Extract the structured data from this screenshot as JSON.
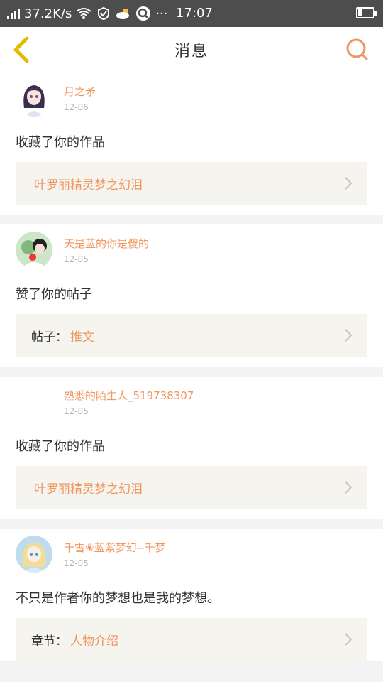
{
  "statusbar": {
    "speed": "37.2K/s",
    "time": "17:07",
    "dots": "···"
  },
  "header": {
    "title": "消息"
  },
  "notifications": [
    {
      "username": "月之矛",
      "date": "12-06",
      "action": "收藏了你的作品",
      "target_prefix": "",
      "target_value": "叶罗丽精灵梦之幻泪",
      "avatar_icon": "avatar-girl-purple-hair"
    },
    {
      "username": "天是蓝的你是傻的",
      "date": "12-05",
      "action": "赞了你的帖子",
      "target_prefix": "帖子：",
      "target_value": "推文",
      "avatar_icon": "avatar-couple-green"
    },
    {
      "username": "熟悉的陌生人_519738307",
      "date": "12-05",
      "action": "收藏了你的作品",
      "target_prefix": "",
      "target_value": "叶罗丽精灵梦之幻泪",
      "avatar_icon": "avatar-empty"
    },
    {
      "username": "千雪❀蓝紫梦幻--千梦",
      "date": "12-05",
      "action": "不只是作者你的梦想也是我的梦想。",
      "target_prefix": "章节：",
      "target_value": "人物介绍",
      "avatar_icon": "avatar-girl-blonde"
    }
  ],
  "colors": {
    "accent": "#f0965f",
    "back_arrow": "#e6b800",
    "search": "#f0965f",
    "statusbar_bg": "#4d4d4d",
    "target_bg": "#f5f4ef"
  }
}
